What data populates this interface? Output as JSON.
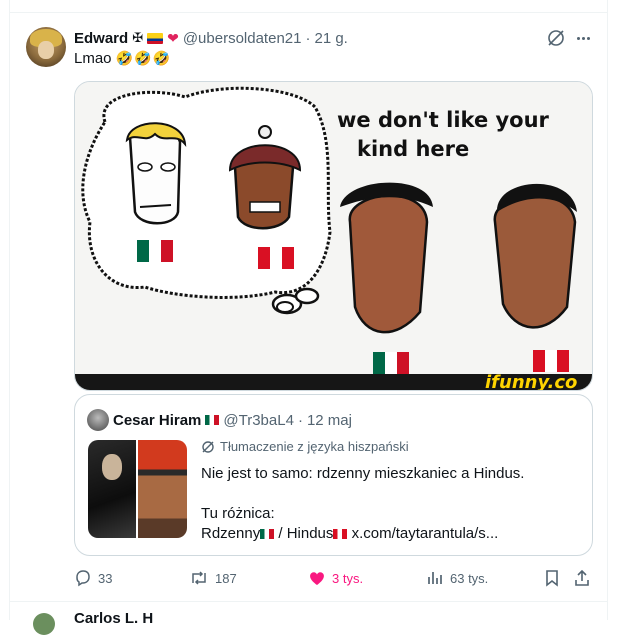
{
  "tweet": {
    "author_name": "Edward",
    "author_handle": "@ubersoldaten21",
    "time": "21 g.",
    "separator": "·",
    "text": "Lmao",
    "emoji_text": "🤣🤣🤣",
    "header_emoji": [
      "✠",
      "colombia-flag",
      "heart-on-fire"
    ]
  },
  "meme": {
    "caption_line1": "we don't like your",
    "caption_line2": "kind here",
    "watermark": "ifunny.co"
  },
  "quote": {
    "author_name": "Cesar Hiram",
    "author_handle": "@Tr3baL4",
    "time": "12 maj",
    "translated_label": "Tłumaczenie z języka hiszpański",
    "line1": "Nie jest to samo: rdzenny mieszkaniec a Hindus.",
    "line2": "Tu różnica:",
    "line3a": "Rdzenny",
    "line3b": " / Hindus",
    "link": "x.com/taytarantula/s..."
  },
  "actions": {
    "replies": "33",
    "reposts": "187",
    "likes": "3 tys.",
    "views": "63 tys."
  },
  "colors": {
    "like": "#f91880",
    "muted": "#536471",
    "border": "#cfd9de"
  },
  "next_tweet": {
    "author_partial": "Carlos L. H"
  }
}
